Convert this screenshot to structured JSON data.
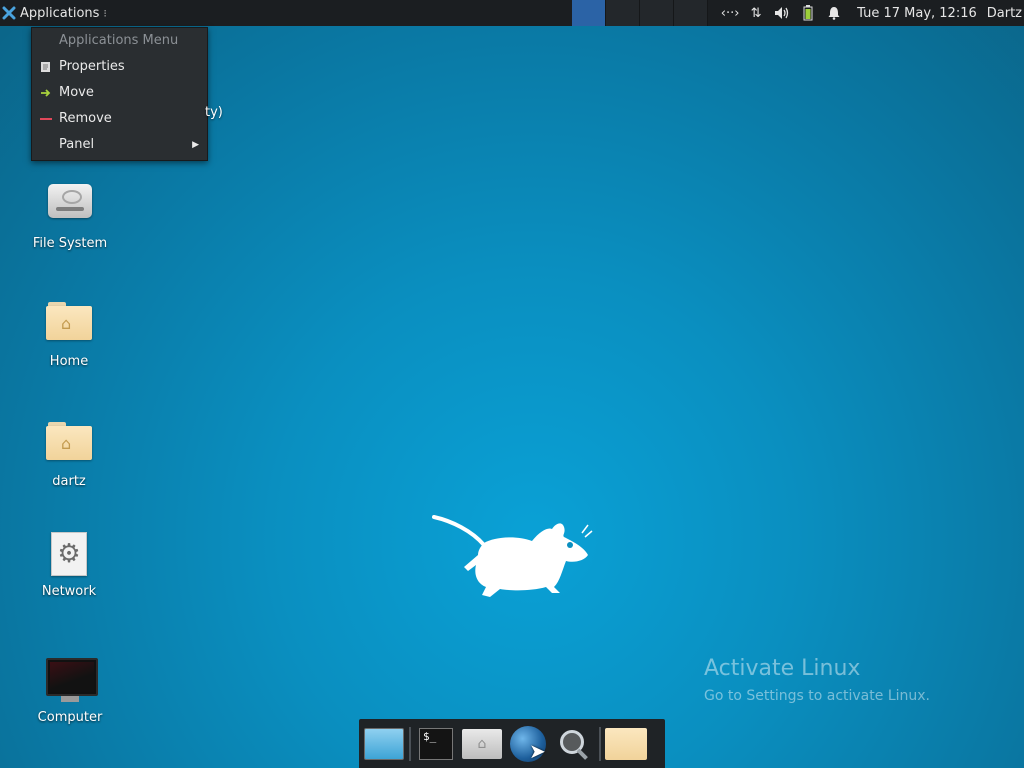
{
  "top_panel": {
    "applications_label": "Applications",
    "clock": "Tue 17 May, 12:16",
    "user": "Dartz",
    "workspaces": [
      {
        "active": true
      },
      {
        "active": false
      },
      {
        "active": false
      },
      {
        "active": false
      }
    ],
    "tray_icons": [
      "network-arrows-icon",
      "updown-arrows-icon",
      "volume-icon",
      "battery-icon",
      "notification-bell-icon"
    ]
  },
  "context_menu": {
    "header": "Applications Menu",
    "items": [
      {
        "label": "Properties",
        "icon": "properties-icon"
      },
      {
        "label": "Move",
        "icon": "move-arrow-icon"
      },
      {
        "label": "Remove",
        "icon": "remove-dash-icon"
      },
      {
        "label": "Panel",
        "icon": "submenu-arrow-icon"
      }
    ]
  },
  "desktop": {
    "partial_label": "ty)",
    "icons": [
      {
        "label": "File System",
        "icon": "drive-icon"
      },
      {
        "label": "Home",
        "icon": "home-folder-icon"
      },
      {
        "label": "dartz",
        "icon": "home-folder-icon"
      },
      {
        "label": "Network",
        "icon": "network-gear-icon"
      },
      {
        "label": "Computer",
        "icon": "monitor-icon"
      }
    ]
  },
  "watermark": {
    "title": "Activate Linux",
    "subtitle": "Go to Settings to activate Linux."
  },
  "dock": {
    "items": [
      "show-desktop-icon",
      "terminal-icon",
      "file-manager-icon",
      "web-browser-icon",
      "app-finder-icon",
      "folder-icon"
    ],
    "terminal_glyph": "$_"
  },
  "colors": {
    "panel_bg": "#1b1e21",
    "menu_bg": "#2a2e31",
    "workspace_active": "#2b63a6",
    "desktop_bg": "#0a8fc0",
    "move_icon": "#a9d33d",
    "remove_icon": "#e0485a"
  }
}
